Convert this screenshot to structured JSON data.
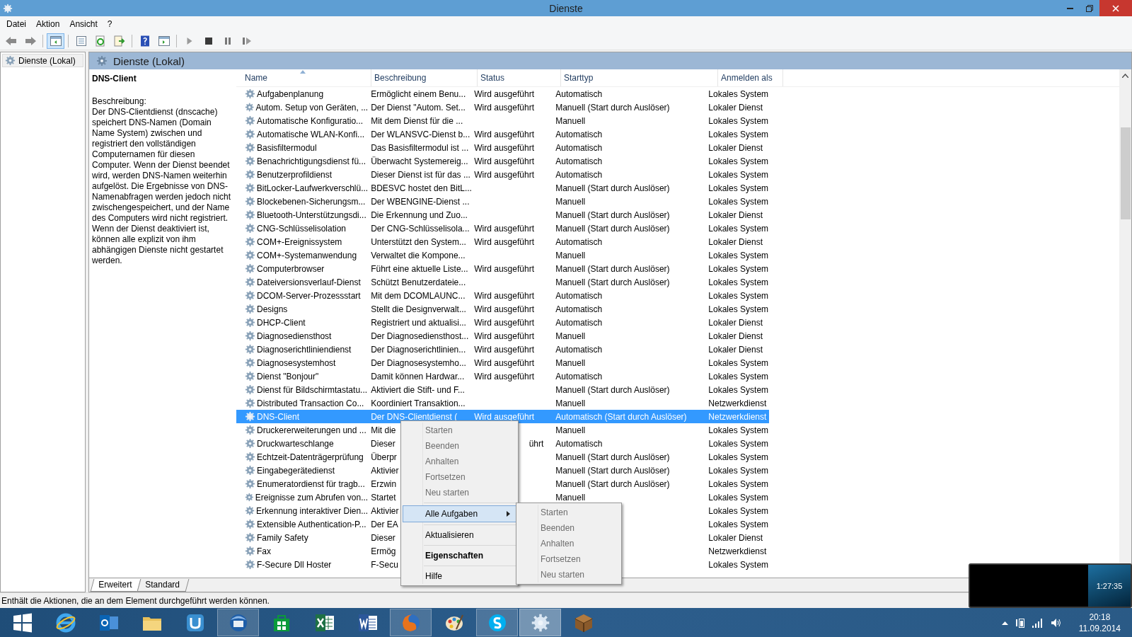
{
  "window": {
    "title": "Dienste"
  },
  "menu_bar": [
    {
      "label": "Datei"
    },
    {
      "label": "Aktion"
    },
    {
      "label": "Ansicht"
    },
    {
      "label": "?"
    }
  ],
  "toolbar": [
    {
      "kind": "back",
      "selected": false
    },
    {
      "kind": "forward",
      "selected": false
    },
    {
      "kind": "separator"
    },
    {
      "kind": "tree",
      "selected": true
    },
    {
      "kind": "separator"
    },
    {
      "kind": "properties",
      "selected": false
    },
    {
      "kind": "refresh",
      "selected": false
    },
    {
      "kind": "export",
      "selected": false
    },
    {
      "kind": "separator"
    },
    {
      "kind": "help",
      "selected": false
    },
    {
      "kind": "pane",
      "selected": false
    },
    {
      "kind": "separator"
    },
    {
      "kind": "play",
      "selected": false
    },
    {
      "kind": "stop",
      "selected": false
    },
    {
      "kind": "pause",
      "selected": false
    },
    {
      "kind": "resume",
      "selected": false
    }
  ],
  "tree": {
    "items": [
      {
        "label": "Dienste (Lokal)",
        "selected": true
      }
    ]
  },
  "panel": {
    "title": "Dienste (Lokal)"
  },
  "details": {
    "name": "DNS-Client",
    "description_label": "Beschreibung:",
    "description": "Der DNS-Clientdienst (dnscache) speichert DNS-Namen (Domain Name System) zwischen und registriert den vollständigen Computernamen für diesen Computer. Wenn der Dienst beendet wird, werden DNS-Namen weiterhin aufgelöst. Die Ergebnisse von DNS-Namenabfragen werden jedoch nicht zwischengespeichert, und der Name des Computers wird nicht registriert. Wenn der Dienst deaktiviert ist, können alle explizit von ihm abhängigen Dienste nicht gestartet werden."
  },
  "table": {
    "columns": [
      {
        "label": "Name",
        "sorted": true
      },
      {
        "label": "Beschreibung",
        "sorted": false
      },
      {
        "label": "Status",
        "sorted": false
      },
      {
        "label": "Starttyp",
        "sorted": false
      },
      {
        "label": "Anmelden als",
        "sorted": false
      }
    ],
    "rows": [
      {
        "name": "Aufgabenplanung",
        "description": "Ermöglicht einem Benu...",
        "status": "Wird ausgeführt",
        "startup": "Automatisch",
        "logon": "Lokales System",
        "selected": false
      },
      {
        "name": "Autom. Setup von Geräten, ...",
        "description": "Der Dienst \"Autom. Set...",
        "status": "Wird ausgeführt",
        "startup": "Manuell (Start durch Auslöser)",
        "logon": "Lokaler Dienst",
        "selected": false
      },
      {
        "name": "Automatische Konfiguratio...",
        "description": "Mit dem Dienst für die ...",
        "startup": "Manuell",
        "logon": "Lokales System",
        "selected": false
      },
      {
        "name": "Automatische WLAN-Konfi...",
        "description": "Der WLANSVC-Dienst b...",
        "status": "Wird ausgeführt",
        "startup": "Automatisch",
        "logon": "Lokales System",
        "selected": false
      },
      {
        "name": "Basisfiltermodul",
        "description": "Das Basisfiltermodul ist ...",
        "status": "Wird ausgeführt",
        "startup": "Automatisch",
        "logon": "Lokaler Dienst",
        "selected": false
      },
      {
        "name": "Benachrichtigungsdienst fü...",
        "description": "Überwacht Systemereig...",
        "status": "Wird ausgeführt",
        "startup": "Automatisch",
        "logon": "Lokales System",
        "selected": false
      },
      {
        "name": "Benutzerprofildienst",
        "description": "Dieser Dienst ist für das ...",
        "status": "Wird ausgeführt",
        "startup": "Automatisch",
        "logon": "Lokales System",
        "selected": false
      },
      {
        "name": "BitLocker-Laufwerkverschlü...",
        "description": "BDESVC hostet den BitL...",
        "startup": "Manuell (Start durch Auslöser)",
        "logon": "Lokales System",
        "selected": false
      },
      {
        "name": "Blockebenen-Sicherungsm...",
        "description": "Der WBENGINE-Dienst ...",
        "startup": "Manuell",
        "logon": "Lokales System",
        "selected": false
      },
      {
        "name": "Bluetooth-Unterstützungsdi...",
        "description": "Die Erkennung und Zuo...",
        "startup": "Manuell (Start durch Auslöser)",
        "logon": "Lokaler Dienst",
        "selected": false
      },
      {
        "name": "CNG-Schlüsselisolation",
        "description": "Der CNG-Schlüsselisola...",
        "status": "Wird ausgeführt",
        "startup": "Manuell (Start durch Auslöser)",
        "logon": "Lokales System",
        "selected": false
      },
      {
        "name": "COM+-Ereignissystem",
        "description": "Unterstützt den System...",
        "status": "Wird ausgeführt",
        "startup": "Automatisch",
        "logon": "Lokaler Dienst",
        "selected": false
      },
      {
        "name": "COM+-Systemanwendung",
        "description": "Verwaltet die Kompone...",
        "startup": "Manuell",
        "logon": "Lokales System",
        "selected": false
      },
      {
        "name": "Computerbrowser",
        "description": "Führt eine aktuelle Liste...",
        "status": "Wird ausgeführt",
        "startup": "Manuell (Start durch Auslöser)",
        "logon": "Lokales System",
        "selected": false
      },
      {
        "name": "Dateiversionsverlauf-Dienst",
        "description": "Schützt Benutzerdateie...",
        "startup": "Manuell (Start durch Auslöser)",
        "logon": "Lokales System",
        "selected": false
      },
      {
        "name": "DCOM-Server-Prozessstart",
        "description": "Mit dem DCOMLAUNC...",
        "status": "Wird ausgeführt",
        "startup": "Automatisch",
        "logon": "Lokales System",
        "selected": false
      },
      {
        "name": "Designs",
        "description": "Stellt die Designverwalt...",
        "status": "Wird ausgeführt",
        "startup": "Automatisch",
        "logon": "Lokales System",
        "selected": false
      },
      {
        "name": "DHCP-Client",
        "description": "Registriert und aktualisi...",
        "status": "Wird ausgeführt",
        "startup": "Automatisch",
        "logon": "Lokaler Dienst",
        "selected": false
      },
      {
        "name": "Diagnosediensthost",
        "description": "Der Diagnosediensthost...",
        "status": "Wird ausgeführt",
        "startup": "Manuell",
        "logon": "Lokaler Dienst",
        "selected": false
      },
      {
        "name": "Diagnoserichtliniendienst",
        "description": "Der Diagnoserichtlinien...",
        "status": "Wird ausgeführt",
        "startup": "Automatisch",
        "logon": "Lokaler Dienst",
        "selected": false
      },
      {
        "name": "Diagnosesystemhost",
        "description": "Der Diagnosesystemho...",
        "status": "Wird ausgeführt",
        "startup": "Manuell",
        "logon": "Lokales System",
        "selected": false
      },
      {
        "name": "Dienst \"Bonjour\"",
        "description": "Damit können Hardwar...",
        "status": "Wird ausgeführt",
        "startup": "Automatisch",
        "logon": "Lokales System",
        "selected": false
      },
      {
        "name": "Dienst für Bildschirmtastatu...",
        "description": "Aktiviert die Stift- und F...",
        "startup": "Manuell (Start durch Auslöser)",
        "logon": "Lokales System",
        "selected": false
      },
      {
        "name": "Distributed Transaction Co...",
        "description": "Koordiniert Transaktion...",
        "startup": "Manuell",
        "logon": "Netzwerkdienst",
        "selected": false
      },
      {
        "name": "DNS-Client",
        "description": "Der DNS-Clientdienst (",
        "status": "Wird ausgeführt",
        "startup": "Automatisch (Start durch Auslöser)",
        "logon": "Netzwerkdienst",
        "selected": true
      },
      {
        "name": "Druckererweiterungen und ...",
        "description": "Mit die",
        "startup": "Manuell",
        "logon": "Lokales System",
        "selected": false
      },
      {
        "name": "Druckwarteschlange",
        "description": "Dieser",
        "status": "ührt",
        "status_cut": true,
        "startup": "Automatisch",
        "logon": "Lokales System",
        "selected": false
      },
      {
        "name": "Echtzeit-Datenträgerprüfung",
        "description": "Überpr",
        "startup": "Manuell (Start durch Auslöser)",
        "logon": "Lokales System",
        "selected": false
      },
      {
        "name": "Eingabegerätedienst",
        "description": "Aktivier",
        "startup": "Manuell (Start durch Auslöser)",
        "logon": "Lokales System",
        "selected": false
      },
      {
        "name": "Enumeratordienst für tragb...",
        "description": "Erzwin",
        "startup": "Manuell (Start durch Auslöser)",
        "logon": "Lokales System",
        "selected": false
      },
      {
        "name": "Ereignisse zum Abrufen von...",
        "description": "Startet",
        "startup": "Manuell",
        "logon": "Lokales System",
        "selected": false
      },
      {
        "name": "Erkennung interaktiver Dien...",
        "description": "Aktivier",
        "logon": "Lokales System",
        "selected": false
      },
      {
        "name": "Extensible Authentication-P...",
        "description": "Der EA",
        "logon": "Lokales System",
        "selected": false
      },
      {
        "name": "Family Safety",
        "description": "Dieser",
        "logon": "Lokaler Dienst",
        "selected": false
      },
      {
        "name": "Fax",
        "description": "Ermög",
        "logon": "Netzwerkdienst",
        "selected": false
      },
      {
        "name": "F-Secure Dll Hoster",
        "description": "F-Secu",
        "logon": "Lokales System",
        "selected": false
      }
    ]
  },
  "tabs": [
    {
      "label": "Erweitert",
      "selected": true
    },
    {
      "label": "Standard",
      "selected": false
    }
  ],
  "status_bar": "Enthält die Aktionen, die an dem Element durchgeführt werden können.",
  "context_menu": {
    "items": [
      {
        "kind": "item",
        "label": "Starten",
        "disabled": true,
        "selected": false
      },
      {
        "kind": "item",
        "label": "Beenden",
        "disabled": true,
        "selected": false
      },
      {
        "kind": "item",
        "label": "Anhalten",
        "disabled": true,
        "selected": false
      },
      {
        "kind": "item",
        "label": "Fortsetzen",
        "disabled": true,
        "selected": false
      },
      {
        "kind": "item",
        "label": "Neu starten",
        "disabled": true,
        "selected": false
      },
      {
        "kind": "separator"
      },
      {
        "kind": "submenu",
        "label": "Alle Aufgaben",
        "disabled": false,
        "selected": true
      },
      {
        "kind": "separator"
      },
      {
        "kind": "item",
        "label": "Aktualisieren",
        "disabled": false,
        "selected": false
      },
      {
        "kind": "separator"
      },
      {
        "kind": "default",
        "label": "Eigenschaften",
        "disabled": false,
        "selected": false
      },
      {
        "kind": "separator"
      },
      {
        "kind": "item",
        "label": "Hilfe",
        "disabled": false,
        "selected": false
      }
    ]
  },
  "submenu": {
    "items": [
      {
        "label": "Starten",
        "disabled": true
      },
      {
        "label": "Beenden",
        "disabled": true
      },
      {
        "label": "Anhalten",
        "disabled": true
      },
      {
        "label": "Fortsetzen",
        "disabled": true
      },
      {
        "label": "Neu starten",
        "disabled": true
      }
    ]
  },
  "overlay": {
    "time": "1:27:35"
  },
  "taskbar": {
    "apps": [
      {
        "kind": "start",
        "running": false,
        "selected": false
      },
      {
        "kind": "browser-e",
        "running": false,
        "selected": false
      },
      {
        "kind": "mail",
        "running": false,
        "selected": false
      },
      {
        "kind": "folder",
        "running": false,
        "selected": false
      },
      {
        "kind": "torrent",
        "running": false,
        "selected": false
      },
      {
        "kind": "bird",
        "running": true,
        "selected": false
      },
      {
        "kind": "store",
        "running": false,
        "selected": false
      },
      {
        "kind": "sheet",
        "running": false,
        "selected": false
      },
      {
        "kind": "doc",
        "running": false,
        "selected": false
      },
      {
        "kind": "fox",
        "running": true,
        "selected": false
      },
      {
        "kind": "palette",
        "running": false,
        "selected": false
      },
      {
        "kind": "chat",
        "running": true,
        "selected": false
      },
      {
        "kind": "gear",
        "running": true,
        "selected": true
      },
      {
        "kind": "crate",
        "running": false,
        "selected": false
      }
    ]
  },
  "tray": {
    "time": "20:18",
    "date": "11.09.2014"
  }
}
